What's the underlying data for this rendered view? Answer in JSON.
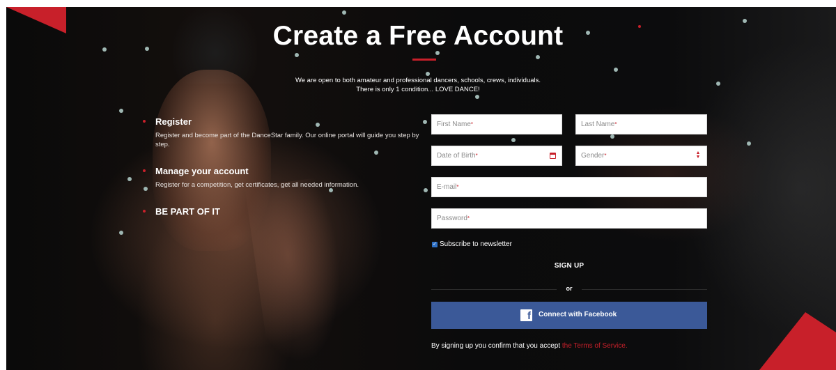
{
  "header": {
    "title": "Create a Free Account",
    "subtitle_line1": "We are open to both amateur and professional dancers, schools, crews, individuals.",
    "subtitle_line2": "There is only 1 condition... LOVE DANCE!"
  },
  "features": [
    {
      "title": "Register",
      "description": "Register and become part of the DanceStar family. Our online portal will guide you step by step."
    },
    {
      "title": "Manage your account",
      "description": "Register for a competition, get certificates, get all needed information."
    },
    {
      "title": "BE PART OF IT",
      "description": ""
    }
  ],
  "form": {
    "first_name_placeholder": "First Name",
    "last_name_placeholder": "Last Name",
    "dob_placeholder": "Date of Birth",
    "gender_placeholder": "Gender",
    "email_placeholder": "E-mail",
    "password_placeholder": "Password",
    "required_marker": "*",
    "subscribe_label": "Subscribe to newsletter",
    "subscribe_checked": true,
    "signup_label": "SIGN UP",
    "or_label": "or",
    "facebook_label": "Connect with Facebook",
    "facebook_icon_glyph": "f",
    "terms_text": "By signing up you confirm that you accept ",
    "terms_link": "the Terms of Service."
  },
  "colors": {
    "accent": "#c8202a",
    "facebook": "#3b5998",
    "checkbox": "#2d6fc4",
    "background": "#0b0b0c"
  }
}
